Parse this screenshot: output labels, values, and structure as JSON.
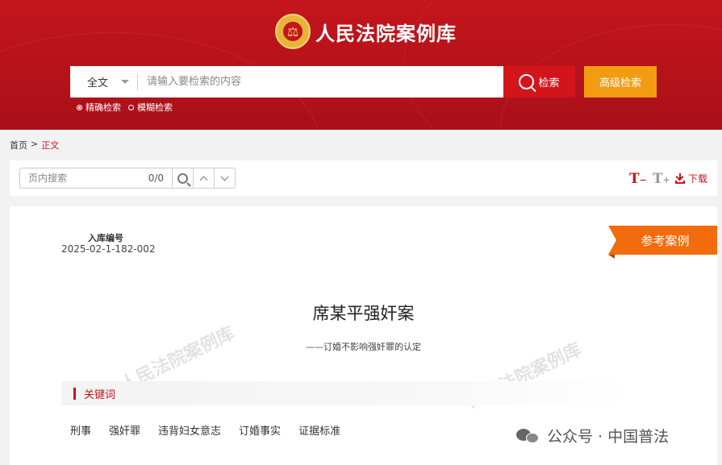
{
  "header": {
    "site_title": "人民法院案例库",
    "search": {
      "scope": "全文",
      "placeholder": "请输入要检索的内容",
      "search_label": "检索",
      "advanced_label": "高级检索",
      "modes": [
        {
          "label": "精确检索",
          "selected": true
        },
        {
          "label": "模糊检索",
          "selected": false
        }
      ]
    }
  },
  "breadcrumb": {
    "home": "首页",
    "separator": ">",
    "current": "正文"
  },
  "toolbar": {
    "page_search_placeholder": "页内搜索",
    "match_count": "0/0",
    "font_decrease": "T",
    "font_decrease_sign": "−",
    "font_increase": "T",
    "font_increase_sign": "+",
    "download_label": "下载"
  },
  "case": {
    "id_label": "入库编号",
    "id_value": "2025-02-1-182-002",
    "ribbon": "参考案例",
    "title": "席某平强奸案",
    "subtitle": "——订婚不影响强奸罪的认定",
    "keywords_heading": "关键词",
    "keywords": [
      "刑事",
      "强奸罪",
      "违背妇女意志",
      "订婚事实",
      "证据标准"
    ],
    "watermark": "人民法院案例库"
  },
  "overlay": {
    "wechat_text": "公众号 · 中国普法"
  },
  "colors": {
    "brand_red": "#c4151c",
    "advanced_orange": "#f39c12",
    "ribbon_orange": "#f26b0c"
  }
}
